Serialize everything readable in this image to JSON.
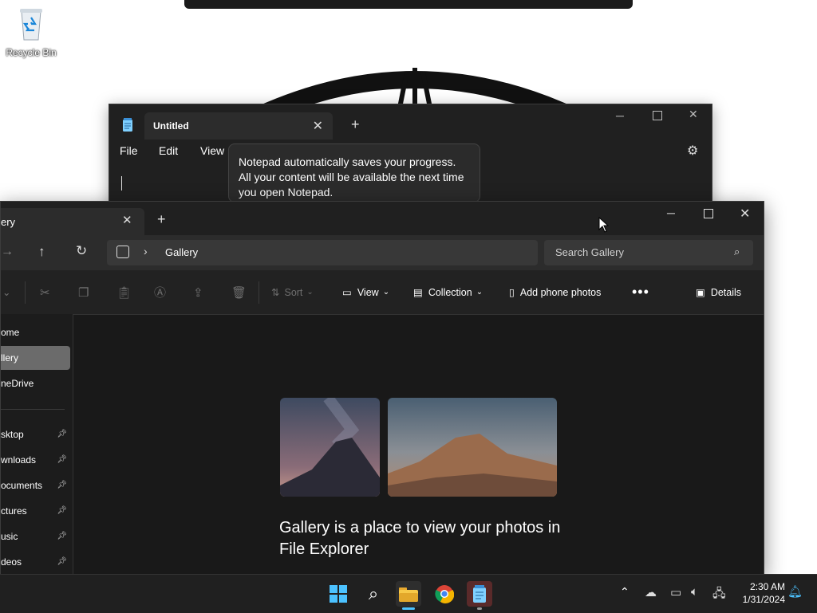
{
  "desktop": {
    "recycle_bin_label": "Recycle Bin"
  },
  "notepad": {
    "tab_title": "Untitled",
    "menus": [
      "File",
      "Edit",
      "View"
    ],
    "tooltip": "Notepad automatically saves your progress. All your content will be available the next time you open Notepad."
  },
  "explorer": {
    "tab_title": "ery",
    "breadcrumb": "Gallery",
    "search_placeholder": "Search Gallery",
    "commands": {
      "sort": "Sort",
      "view": "View",
      "collection": "Collection",
      "add_phone_photos": "Add phone photos",
      "details": "Details"
    },
    "nav": [
      {
        "label": "ome",
        "pinned": false,
        "selected": false
      },
      {
        "label": "llery",
        "pinned": false,
        "selected": true
      },
      {
        "label": "neDrive",
        "pinned": false,
        "selected": false
      },
      {
        "label": "sktop",
        "pinned": true,
        "selected": false
      },
      {
        "label": "wnloads",
        "pinned": true,
        "selected": false
      },
      {
        "label": "ocuments",
        "pinned": true,
        "selected": false
      },
      {
        "label": "ctures",
        "pinned": true,
        "selected": false
      },
      {
        "label": "usic",
        "pinned": true,
        "selected": false
      },
      {
        "label": "deos",
        "pinned": true,
        "selected": false
      }
    ],
    "gallery_heading": "Gallery is a place to view your photos in File Explorer"
  },
  "taskbar": {
    "time": "2:30 AM",
    "date": "1/31/2024"
  },
  "colors": {
    "accent": "#4cc2ff",
    "selected_nav": "#6b6b6b"
  }
}
